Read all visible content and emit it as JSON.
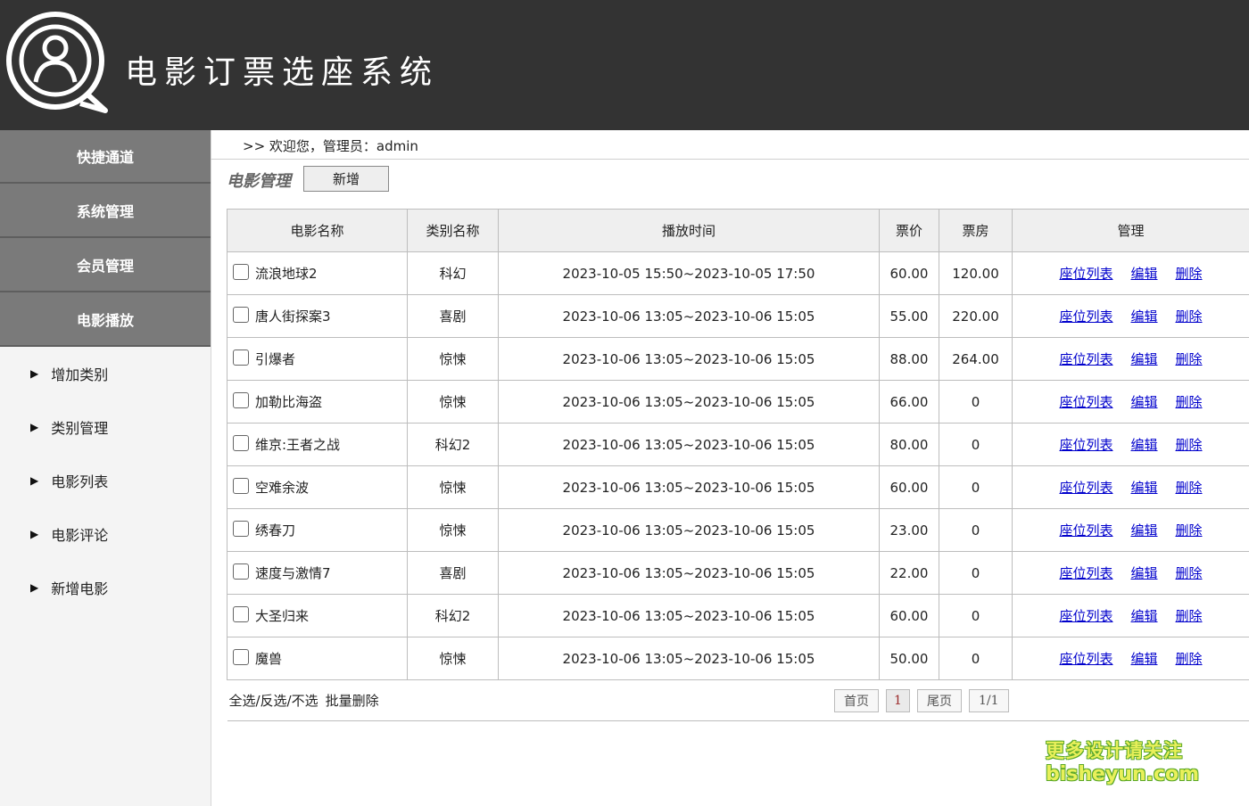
{
  "header": {
    "title": "电影订票选座系统",
    "logo_icon": "user-chat-icon"
  },
  "sidebar": {
    "sections": [
      {
        "label": "快捷通道"
      },
      {
        "label": "系统管理"
      },
      {
        "label": "会员管理"
      },
      {
        "label": "电影播放"
      }
    ],
    "items": [
      {
        "label": "增加类别"
      },
      {
        "label": "类别管理"
      },
      {
        "label": "电影列表"
      },
      {
        "label": "电影评论"
      },
      {
        "label": "新增电影"
      }
    ],
    "arrow": "▶"
  },
  "welcome": ">> 欢迎您，管理员：admin",
  "page": {
    "section_title": "电影管理",
    "add_button": "新增"
  },
  "table": {
    "headers": [
      "电影名称",
      "类别名称",
      "播放时间",
      "票价",
      "票房",
      "管理"
    ],
    "rows": [
      {
        "name": "流浪地球2",
        "category": "科幻",
        "time": "2023-10-05 15:50~2023-10-05 17:50",
        "price": "60.00",
        "box": "120.00"
      },
      {
        "name": "唐人街探案3",
        "category": "喜剧",
        "time": "2023-10-06 13:05~2023-10-06 15:05",
        "price": "55.00",
        "box": "220.00"
      },
      {
        "name": "引爆者",
        "category": "惊悚",
        "time": "2023-10-06 13:05~2023-10-06 15:05",
        "price": "88.00",
        "box": "264.00"
      },
      {
        "name": "加勒比海盗",
        "category": "惊悚",
        "time": "2023-10-06 13:05~2023-10-06 15:05",
        "price": "66.00",
        "box": "0"
      },
      {
        "name": "维京:王者之战",
        "category": "科幻2",
        "time": "2023-10-06 13:05~2023-10-06 15:05",
        "price": "80.00",
        "box": "0"
      },
      {
        "name": "空难余波",
        "category": "惊悚",
        "time": "2023-10-06 13:05~2023-10-06 15:05",
        "price": "60.00",
        "box": "0"
      },
      {
        "name": "绣春刀",
        "category": "惊悚",
        "time": "2023-10-06 13:05~2023-10-06 15:05",
        "price": "23.00",
        "box": "0"
      },
      {
        "name": "速度与激情7",
        "category": "喜剧",
        "time": "2023-10-06 13:05~2023-10-06 15:05",
        "price": "22.00",
        "box": "0"
      },
      {
        "name": "大圣归来",
        "category": "科幻2",
        "time": "2023-10-06 13:05~2023-10-06 15:05",
        "price": "60.00",
        "box": "0"
      },
      {
        "name": "魔兽",
        "category": "惊悚",
        "time": "2023-10-06 13:05~2023-10-06 15:05",
        "price": "50.00",
        "box": "0"
      }
    ],
    "actions": {
      "seats": "座位列表",
      "edit": "编辑",
      "delete": "删除"
    }
  },
  "footer": {
    "select_all": "全选/反选/不选",
    "batch_delete": "批量删除",
    "pager": {
      "first": "首页",
      "current": "1",
      "last": "尾页",
      "info": "1/1"
    }
  },
  "watermark": {
    "line1": "更多设计请关注",
    "line2": "bisheyun.com"
  }
}
